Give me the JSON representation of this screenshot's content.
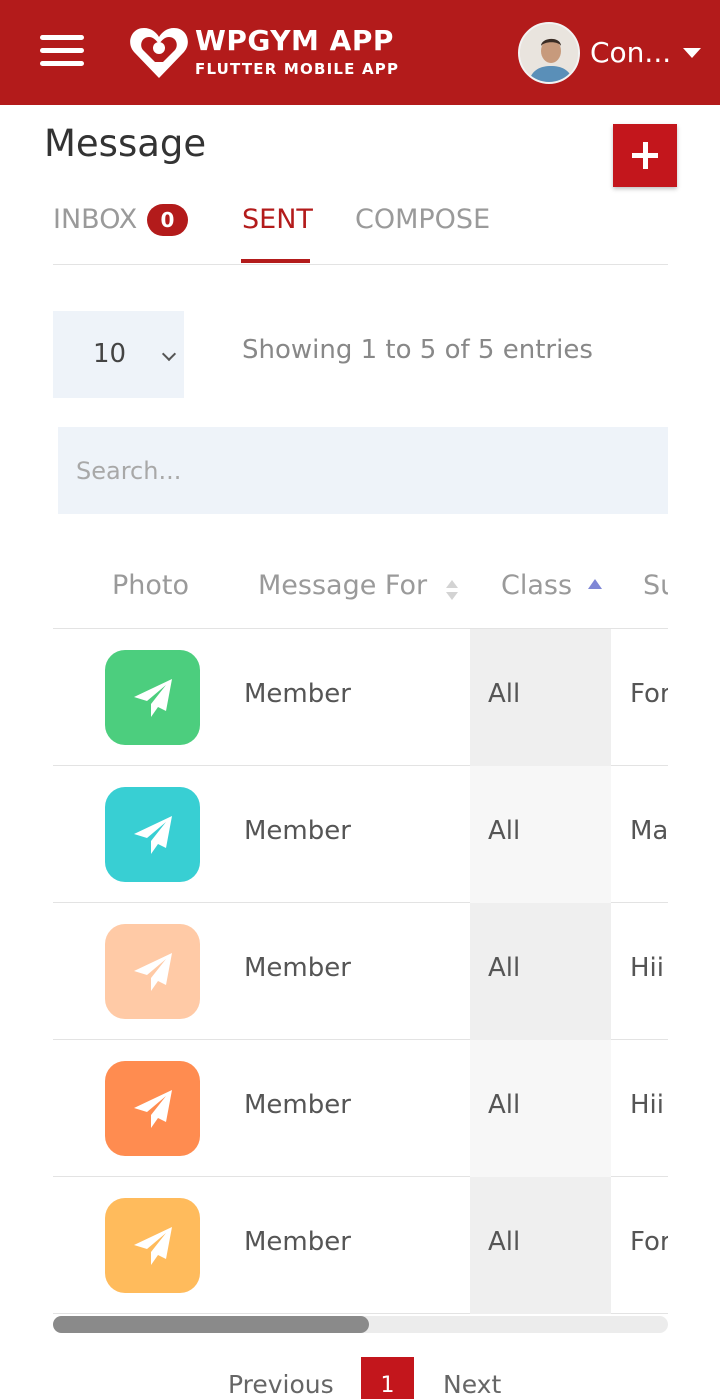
{
  "header": {
    "brand_title": "WPGYM APP",
    "brand_subtitle": "FLUTTER MOBILE APP",
    "user_name": "Con..."
  },
  "page": {
    "title": "Message"
  },
  "tabs": {
    "inbox_label": "INBOX",
    "inbox_count": "0",
    "sent_label": "SENT",
    "compose_label": "COMPOSE",
    "active": "SENT"
  },
  "list_controls": {
    "page_length": "10",
    "info": "Showing 1 to 5 of 5 entries",
    "search_placeholder": "Search..."
  },
  "table": {
    "columns": [
      "Photo",
      "Message For",
      "Class",
      "Su"
    ],
    "rows": [
      {
        "message_for": "Member",
        "class": "All",
        "subject": "For",
        "icon_color": "#4cce7e"
      },
      {
        "message_for": "Member",
        "class": "All",
        "subject": "Ma",
        "icon_color": "#38cfd3"
      },
      {
        "message_for": "Member",
        "class": "All",
        "subject": "Hii",
        "icon_color": "#ffcaa6"
      },
      {
        "message_for": "Member",
        "class": "All",
        "subject": "Hii",
        "icon_color": "#ff8c50"
      },
      {
        "message_for": "Member",
        "class": "All",
        "subject": "For",
        "icon_color": "#ffbb5c"
      }
    ]
  },
  "pagination": {
    "previous": "Previous",
    "current": "1",
    "next": "Next"
  },
  "colors": {
    "brand": "#b31b1b",
    "accent_button": "#c3161c",
    "sort_indicator": "#7f87d6"
  },
  "icons": {
    "menu": "hamburger-icon",
    "logo": "heart-logo-icon",
    "dropdown": "caret-down-icon",
    "add": "plus-icon",
    "row_photo": "paper-plane-icon"
  }
}
